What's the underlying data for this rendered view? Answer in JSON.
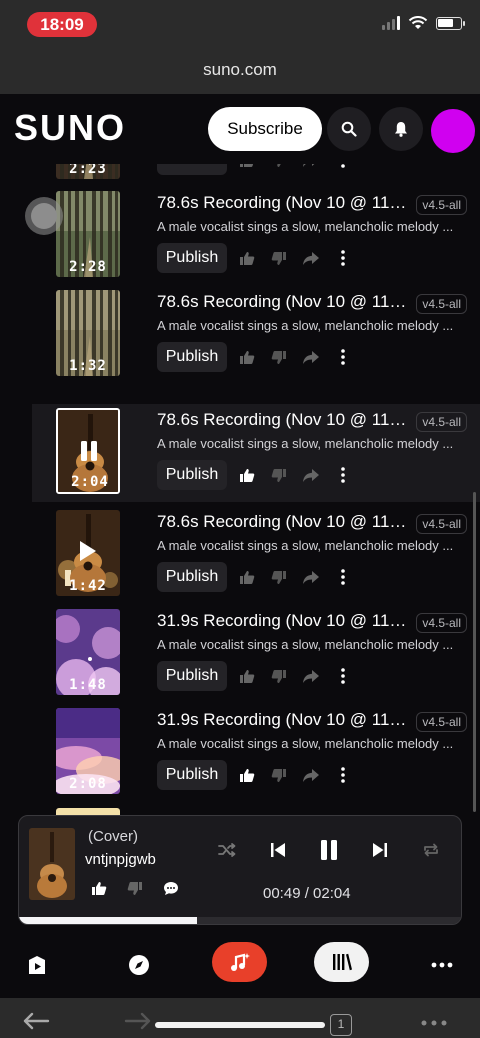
{
  "status": {
    "time": "18:09"
  },
  "browser": {
    "url": "suno.com",
    "tab_count": "1"
  },
  "header": {
    "logo": "SUNO",
    "subscribe_label": "Subscribe"
  },
  "songs": [
    {
      "title": "",
      "badge": "",
      "description": "",
      "duration": "2:23",
      "publish_label": "Publish",
      "liked": false,
      "thumb": "forest-dark"
    },
    {
      "title": "78.6s Recording (Nov 10 @ 11:...",
      "badge": "v4.5-all",
      "description": "A male vocalist sings a slow, melancholic melody ...",
      "duration": "2:28",
      "publish_label": "Publish",
      "liked": false,
      "thumb": "forest"
    },
    {
      "title": "78.6s Recording (Nov 10 @ 11:...",
      "badge": "v4.5-all",
      "description": "A male vocalist sings a slow, melancholic melody ...",
      "duration": "1:32",
      "publish_label": "Publish",
      "liked": false,
      "thumb": "forest-light"
    },
    {
      "title": "78.6s Recording (Nov 10 @ 11:...",
      "badge": "v4.5-all",
      "description": "A male vocalist sings a slow, melancholic melody ...",
      "duration": "2:04",
      "publish_label": "Publish",
      "liked": true,
      "thumb": "guitar",
      "playing": true
    },
    {
      "title": "78.6s Recording (Nov 10 @ 11:...",
      "badge": "v4.5-all",
      "description": "A male vocalist sings a slow, melancholic melody ...",
      "duration": "1:42",
      "publish_label": "Publish",
      "liked": false,
      "thumb": "guitar-candle",
      "play_overlay": true
    },
    {
      "title": "31.9s Recording (Nov 10 @ 11:...",
      "badge": "v4.5-all",
      "description": "A male vocalist sings a slow, melancholic melody ...",
      "duration": "1:48",
      "publish_label": "Publish",
      "liked": false,
      "thumb": "purple-clouds"
    },
    {
      "title": "31.9s Recording (Nov 10 @ 11:...",
      "badge": "v4.5-all",
      "description": "A male vocalist sings a slow, melancholic melody ...",
      "duration": "2:08",
      "publish_label": "Publish",
      "liked": true,
      "thumb": "sunset-clouds"
    }
  ],
  "player": {
    "tag": "(Cover)",
    "title": "vntjnpjgwb",
    "time": "00:49 /  02:04",
    "progress": 0.4
  },
  "icons": {
    "search": "search-icon",
    "bell": "bell-icon",
    "like": "thumbs-up-icon",
    "dislike": "thumbs-down-icon",
    "share": "share-icon",
    "more": "more-icon",
    "shuffle": "shuffle-icon",
    "prev": "previous-icon",
    "pause": "pause-icon",
    "next": "next-icon",
    "repeat": "repeat-icon",
    "comment": "comment-icon"
  },
  "colors": {
    "accent_red": "#e8402a",
    "avatar": "#d000f0",
    "time_pill": "#e0323a"
  }
}
